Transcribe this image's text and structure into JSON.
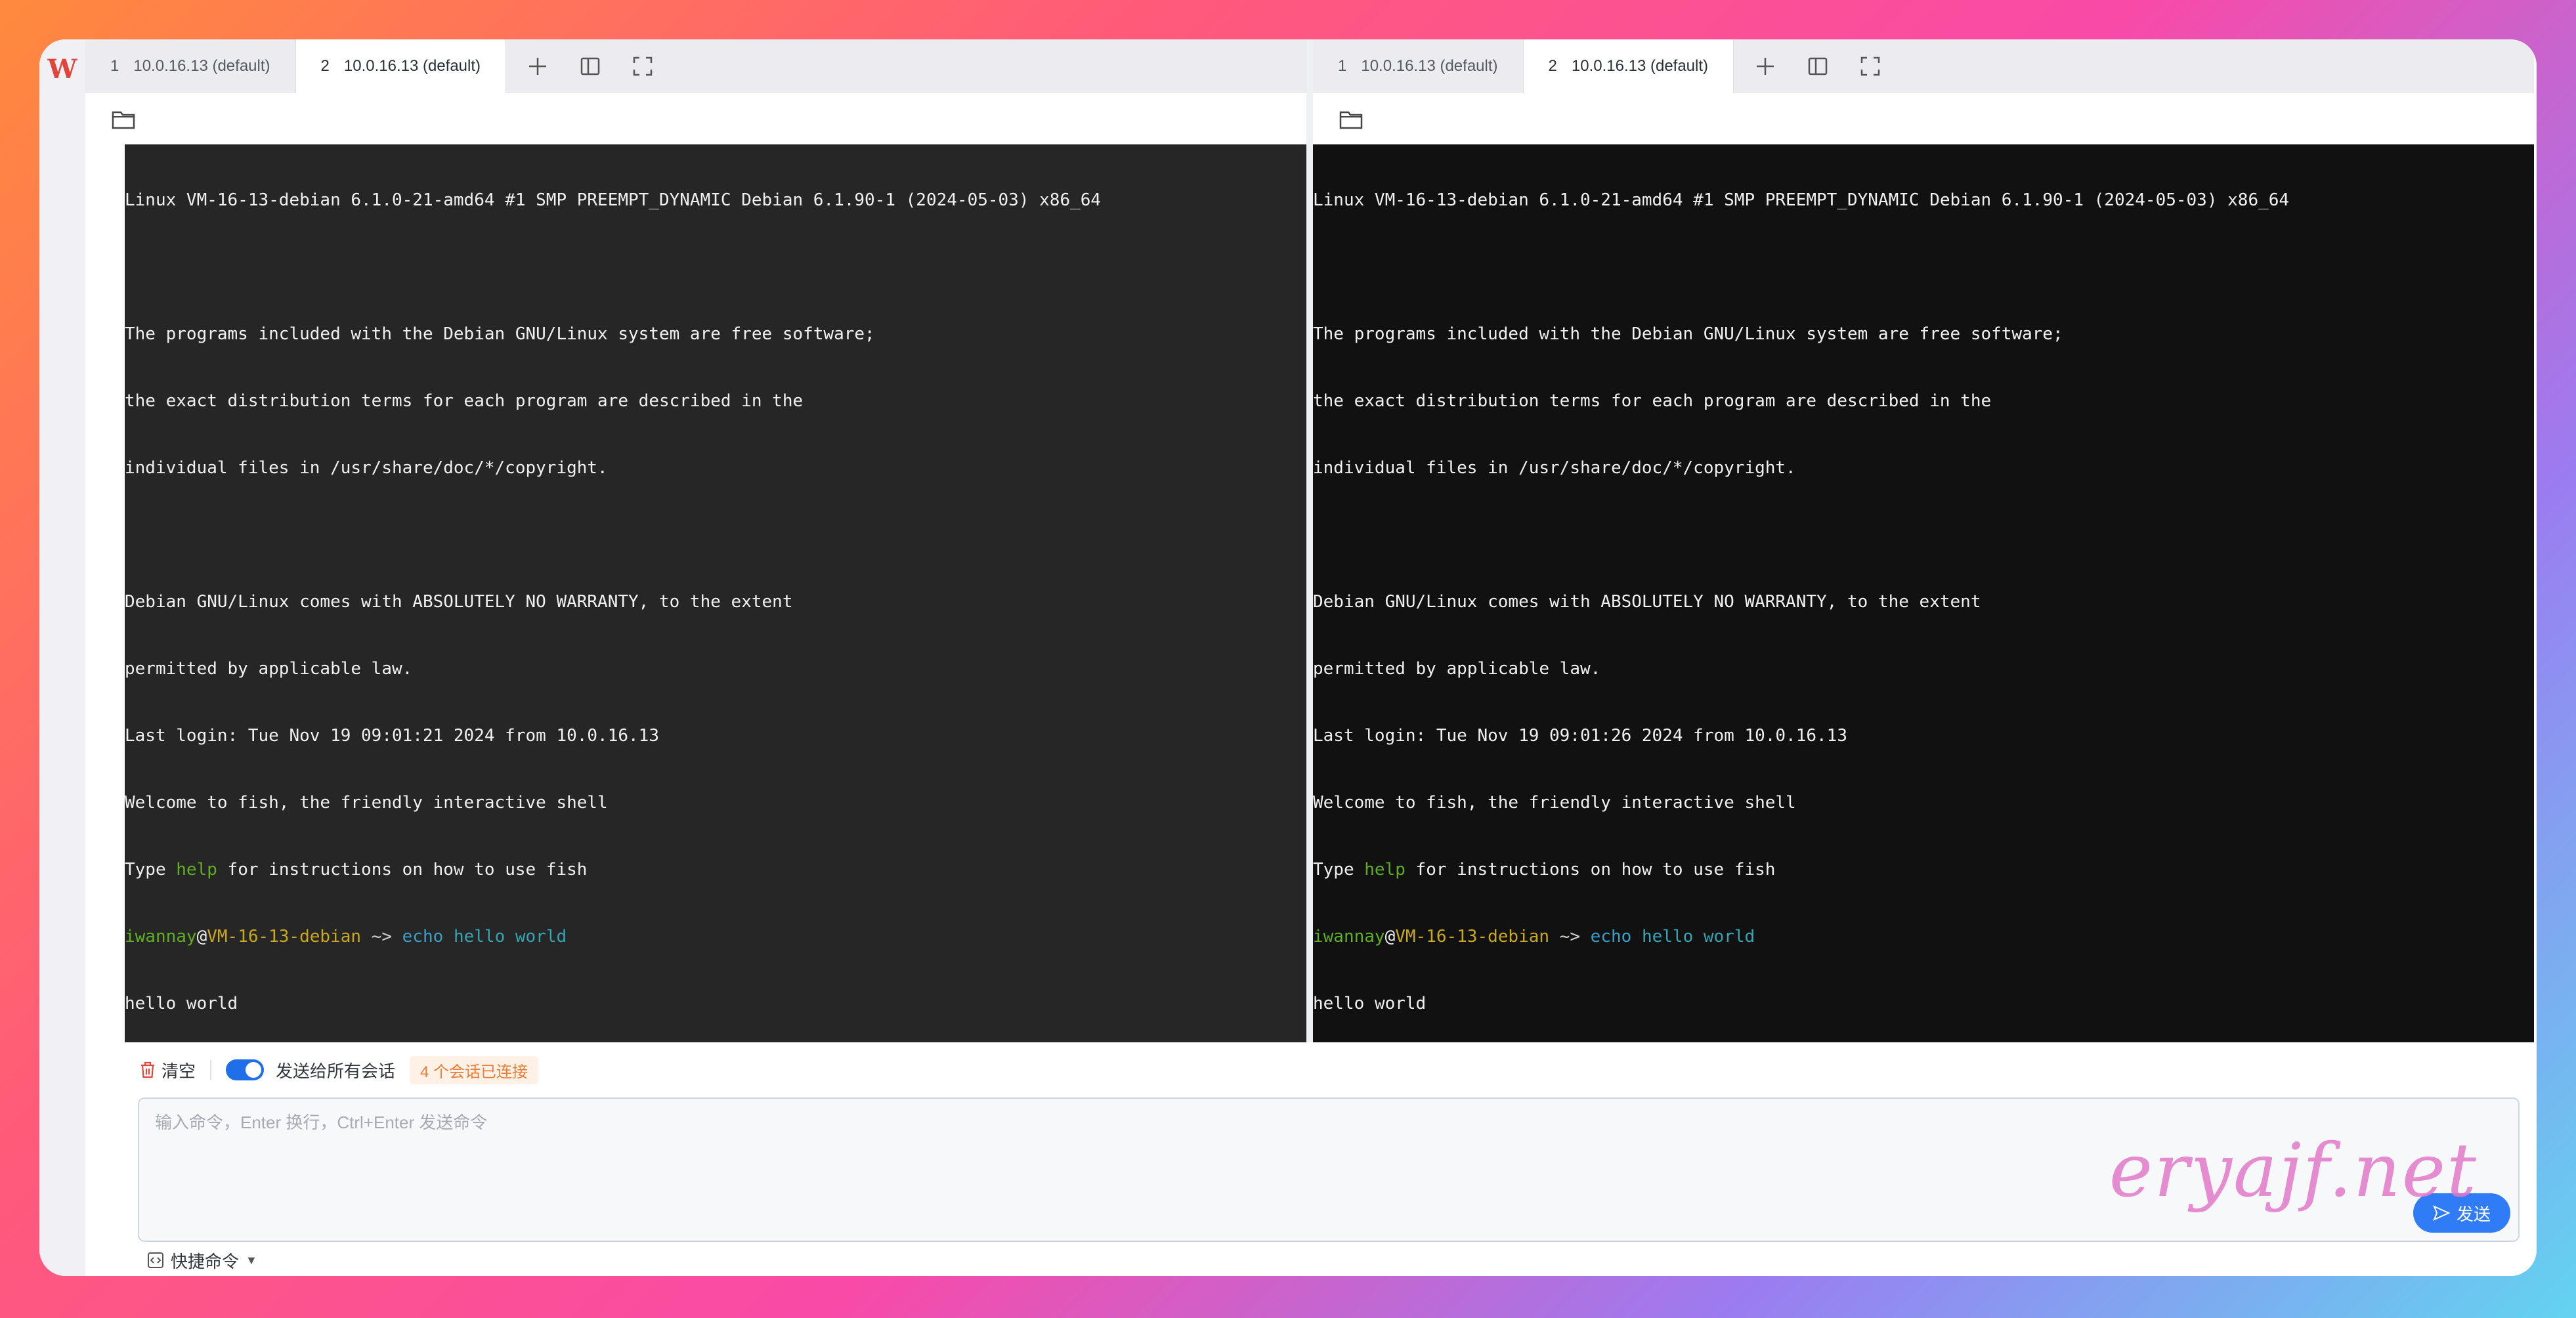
{
  "app": {
    "logo": "W"
  },
  "panes": [
    {
      "tabs": [
        {
          "num": "1",
          "label": "10.0.16.13 (default)",
          "active": false
        },
        {
          "num": "2",
          "label": "10.0.16.13 (default)",
          "active": true
        }
      ],
      "terminal": {
        "banner": "Linux VM-16-13-debian 6.1.0-21-amd64 #1 SMP PREEMPT_DYNAMIC Debian 6.1.90-1 (2024-05-03) x86_64",
        "free1": "The programs included with the Debian GNU/Linux system are free software;",
        "free2": "the exact distribution terms for each program are described in the",
        "free3": "individual files in /usr/share/doc/*/copyright.",
        "warranty1": "Debian GNU/Linux comes with ABSOLUTELY NO WARRANTY, to the extent",
        "warranty2": "permitted by applicable law.",
        "last_login": "Last login: Tue Nov 19 09:01:21 2024 from 10.0.16.13",
        "welcome": "Welcome to fish, the friendly interactive shell",
        "type_pre": "Type ",
        "type_help": "help",
        "type_post": " for instructions on how to use fish",
        "user": "iwannay",
        "at": "@",
        "host": "VM-16-13-debian",
        "prompt_tail": " ~> ",
        "cmd_echo": "echo",
        "cmd_args": " hello world",
        "output": "hello world"
      }
    },
    {
      "tabs": [
        {
          "num": "1",
          "label": "10.0.16.13 (default)",
          "active": false
        },
        {
          "num": "2",
          "label": "10.0.16.13 (default)",
          "active": true
        }
      ],
      "terminal": {
        "banner": "Linux VM-16-13-debian 6.1.0-21-amd64 #1 SMP PREEMPT_DYNAMIC Debian 6.1.90-1 (2024-05-03) x86_64",
        "free1": "The programs included with the Debian GNU/Linux system are free software;",
        "free2": "the exact distribution terms for each program are described in the",
        "free3": "individual files in /usr/share/doc/*/copyright.",
        "warranty1": "Debian GNU/Linux comes with ABSOLUTELY NO WARRANTY, to the extent",
        "warranty2": "permitted by applicable law.",
        "last_login": "Last login: Tue Nov 19 09:01:26 2024 from 10.0.16.13",
        "welcome": "Welcome to fish, the friendly interactive shell",
        "type_pre": "Type ",
        "type_help": "help",
        "type_post": " for instructions on how to use fish",
        "user": "iwannay",
        "at": "@",
        "host": "VM-16-13-debian",
        "prompt_tail": " ~> ",
        "cmd_echo": "echo",
        "cmd_args": " hello world",
        "output": "hello world"
      }
    }
  ],
  "bottom": {
    "clear_label": "清空",
    "broadcast_label": "发送给所有会话",
    "broadcast_on": true,
    "sessions_badge": "4 个会话已连接",
    "input_placeholder": "输入命令，Enter 换行，Ctrl+Enter 发送命令",
    "send_label": "发送",
    "quick_label": "快捷命令"
  },
  "watermark": "eryajf.net",
  "colors": {
    "accent": "#1f6feb",
    "prompt_user": "#5faf1f",
    "prompt_host": "#c8a81c",
    "command": "#3a9fc7",
    "badge_text": "#e8803a"
  }
}
